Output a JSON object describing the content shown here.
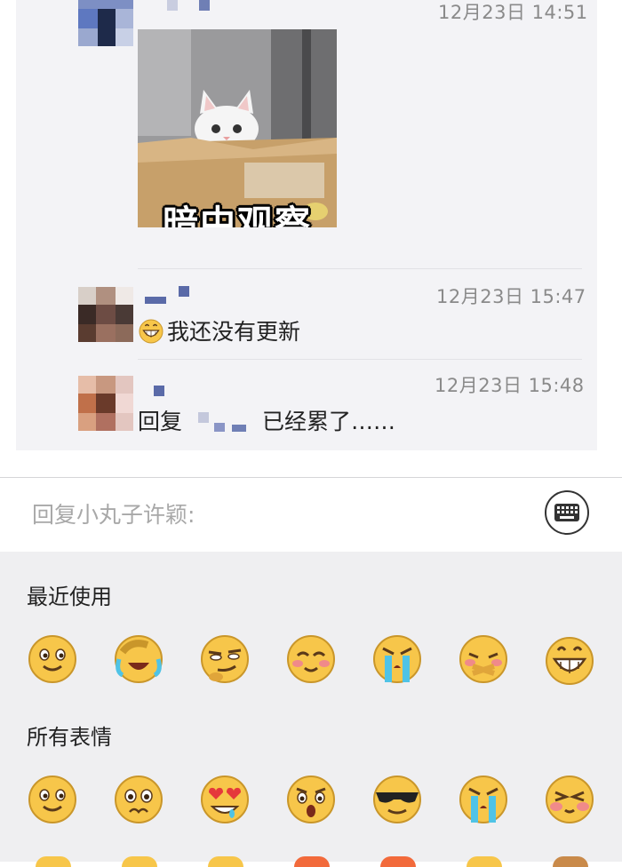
{
  "comments": [
    {
      "timestamp": "12月23日 14:51",
      "sticker": {
        "caption": "暗中观察"
      }
    },
    {
      "timestamp": "12月23日 15:47",
      "emoji": "grin-emoji",
      "text": "我还没有更新"
    },
    {
      "timestamp": "12月23日 15:48",
      "text_prefix": "回复",
      "text_suffix": "已经累了……"
    }
  ],
  "reply": {
    "placeholder": "回复小丸子许颖:"
  },
  "emoji_panel": {
    "recent_title": "最近使用",
    "all_title": "所有表情",
    "recent": [
      "smile-emoji",
      "facepalm-laugh-emoji",
      "smirk-emoji",
      "blush-emoji",
      "crying-emoji",
      "embarrassed-emoji",
      "grin-emoji"
    ],
    "all": [
      "smile-emoji",
      "wronged-emoji",
      "heart-eyes-emoji",
      "surprised-emoji",
      "sunglasses-emoji",
      "crying-emoji",
      "shy-emoji"
    ]
  },
  "colors": {
    "panel_bg": "#f3f3f6",
    "emoji_face": "#f7c64a",
    "tear": "#4fc3e6"
  }
}
